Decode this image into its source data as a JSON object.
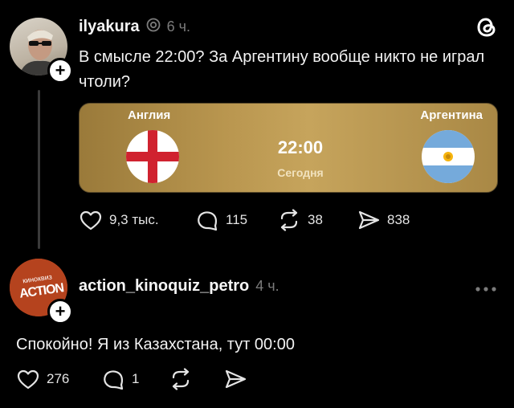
{
  "post": {
    "username": "ilyakura",
    "time": "6 ч.",
    "text": "В смысле 22:00? За Аргентину вообще никто не играл чтоли?",
    "match": {
      "home": "Англия",
      "away": "Аргентина",
      "time": "22:00",
      "day": "Сегодня"
    },
    "likes": "9,3 тыс.",
    "replies": "115",
    "reposts": "38",
    "shares": "838"
  },
  "reply": {
    "username": "action_kinoquiz_petro",
    "time": "4 ч.",
    "avatar_top": "киноквиз",
    "avatar_main": "ACTION",
    "text": "Спокойно! Я из Казахстана, тут 00:00",
    "likes": "276",
    "replies": "1"
  },
  "colors": {
    "background": "#000000",
    "card_gold": "#c6a45c",
    "secondary_text": "#7b7b7b"
  }
}
